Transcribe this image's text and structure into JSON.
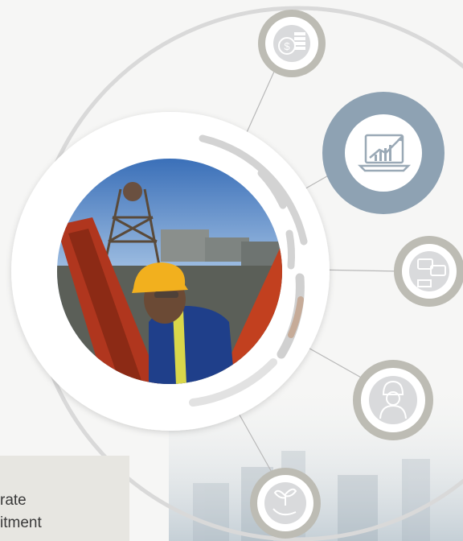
{
  "text_box": {
    "line1": "rate",
    "line2": "itment"
  },
  "icons": [
    {
      "name": "finance-icon"
    },
    {
      "name": "growth-chart-icon"
    },
    {
      "name": "communication-icon"
    },
    {
      "name": "worker-icon"
    },
    {
      "name": "sustainability-icon"
    }
  ],
  "colors": {
    "highlight_ring": "#8ea2b3",
    "ring": "#bdbcb4",
    "icon_fill": "#d9dadc",
    "arc": "#d3d3d3",
    "arc_accent": "#c6ab98"
  }
}
